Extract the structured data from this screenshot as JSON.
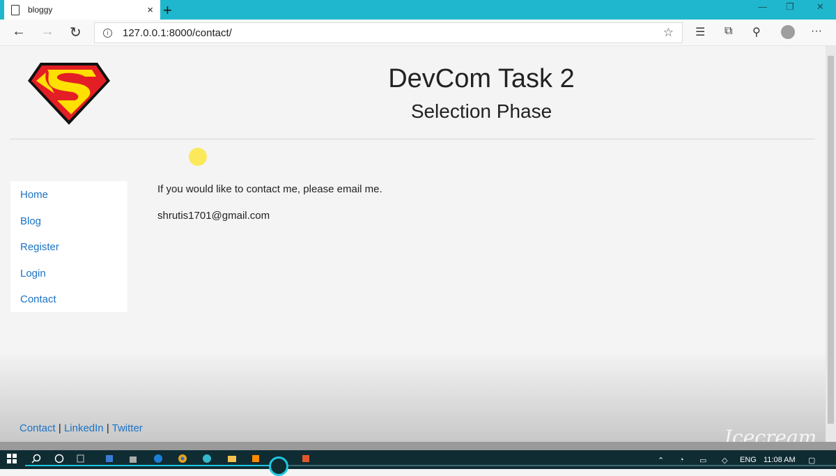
{
  "browser": {
    "tab_title": "bloggy",
    "tab_close": "×",
    "new_tab": "+",
    "minimize": "—",
    "restore": "❐",
    "close": "✕",
    "back": "←",
    "forward": "→",
    "refresh": "↻",
    "url": "127.0.0.1:8000/contact/",
    "more": "···"
  },
  "header": {
    "title": "DevCom Task 2",
    "subtitle": "Selection Phase"
  },
  "sidebar": {
    "items": [
      {
        "label": "Home"
      },
      {
        "label": "Blog"
      },
      {
        "label": "Register"
      },
      {
        "label": "Login"
      },
      {
        "label": "Contact"
      }
    ]
  },
  "content": {
    "line1": "If you would like to contact me, please email me.",
    "email": "shrutis1701@gmail.com"
  },
  "footer": {
    "links": [
      "Contact",
      "LinkedIn",
      "Twitter"
    ],
    "separator": " | "
  },
  "watermark": "Icecream",
  "taskbar": {
    "language": "ENG",
    "time": "11:08 AM"
  },
  "colors": {
    "tabbar": "#1fb7cd",
    "link": "#1a73c4",
    "taskbar": "#0f2c33",
    "logo_red": "#e31e24",
    "logo_yellow": "#ffe000"
  }
}
